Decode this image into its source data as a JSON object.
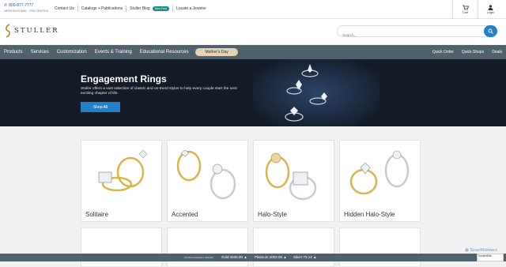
{
  "topbar": {
    "phone": "800-877-7777",
    "hours": "WEEKDAYS 8AM - 7PM CENTRAL",
    "links": [
      "Contact Us",
      "Catalogs + Publications",
      "Stuller Blog",
      "Locate a Jeweler"
    ],
    "blog_badge": "New Post",
    "cart_label": "Cart",
    "login_label": "Login"
  },
  "header": {
    "logo_text": "STULLER",
    "search_placeholder": "Search..."
  },
  "nav": {
    "items": [
      "Products",
      "Services",
      "Customization",
      "Events & Training",
      "Educational Resources"
    ],
    "promo": "Mother's Day",
    "right_items": [
      "Quick Order",
      "Quick Shops",
      "Deals"
    ]
  },
  "hero": {
    "title": "Engagement Rings",
    "text": "Stuller offers a vast selection of classic and on-trend styles to help every couple start the next exciting chapter of life.",
    "button": "Shop All"
  },
  "categories": [
    "Solitaire",
    "Accented",
    "Halo-Style",
    "Hidden Halo-Style"
  ],
  "prices": {
    "note": "3/1/2024 MARKET PRICES",
    "gold": "Gold 4636.90",
    "platinum": "Platinum 2002.00",
    "silver": "Silver 73.14"
  },
  "watermark": "ScanMalware",
  "trust_badge": "TrustedSite"
}
